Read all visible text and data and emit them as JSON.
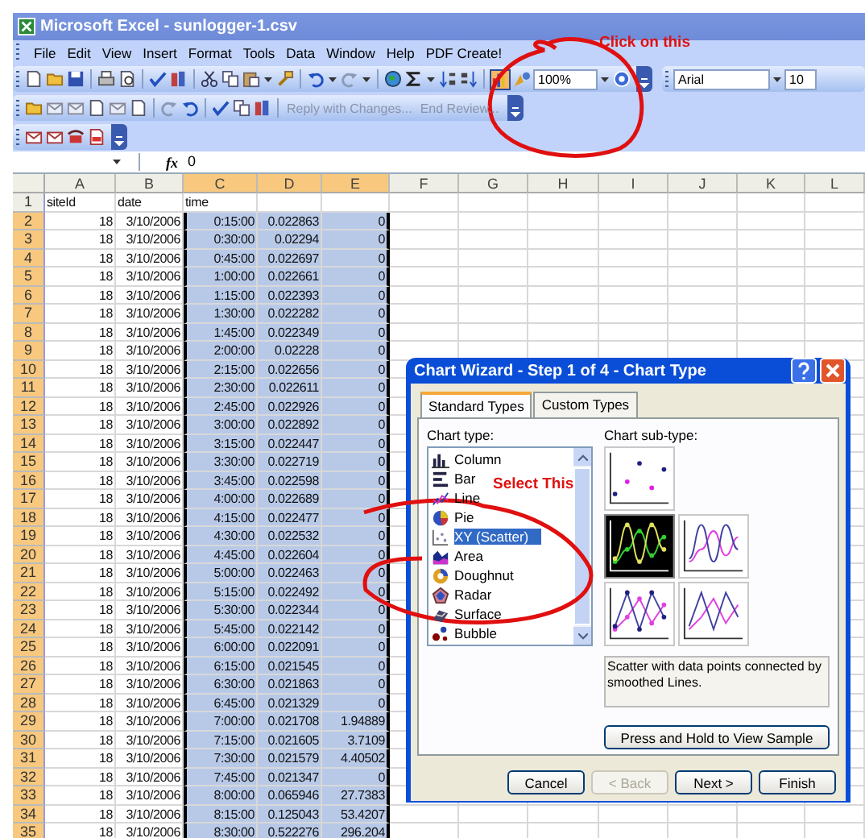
{
  "window": {
    "title": "Microsoft Excel - sunlogger-1.csv"
  },
  "menu": [
    "File",
    "Edit",
    "View",
    "Insert",
    "Format",
    "Tools",
    "Data",
    "Window",
    "Help",
    "PDF Create!"
  ],
  "standard_toolbar": {
    "zoom": "100%",
    "chart_wizard_pressed": true
  },
  "formatting_toolbar": {
    "font": "Arial",
    "size": "10"
  },
  "reviewing_toolbar": {
    "buttons": [
      {
        "label": "Reply with Changes...",
        "disabled": true
      },
      {
        "label": "End Review...",
        "disabled": true
      }
    ]
  },
  "formula_bar": {
    "function_label": "fx",
    "value": "0"
  },
  "sheet": {
    "columns": [
      {
        "label": "A",
        "selected": false
      },
      {
        "label": "B",
        "selected": false
      },
      {
        "label": "C",
        "selected": true
      },
      {
        "label": "D",
        "selected": true
      },
      {
        "label": "E",
        "selected": true
      },
      {
        "label": "F",
        "selected": false
      },
      {
        "label": "G",
        "selected": false
      },
      {
        "label": "H",
        "selected": false
      },
      {
        "label": "I",
        "selected": false
      },
      {
        "label": "J",
        "selected": false
      },
      {
        "label": "K",
        "selected": false
      },
      {
        "label": "L",
        "selected": false
      }
    ],
    "rows": [
      {
        "num": "1",
        "selected": false,
        "cells": [
          "siteId",
          "date",
          "time"
        ]
      },
      {
        "num": "2",
        "selected": true,
        "cells": [
          "18",
          "3/10/2006",
          "0:15:00",
          "0.022863",
          "0"
        ]
      },
      {
        "num": "3",
        "selected": true,
        "cells": [
          "18",
          "3/10/2006",
          "0:30:00",
          "0.02294",
          "0"
        ]
      },
      {
        "num": "4",
        "selected": true,
        "cells": [
          "18",
          "3/10/2006",
          "0:45:00",
          "0.022697",
          "0"
        ]
      },
      {
        "num": "5",
        "selected": true,
        "cells": [
          "18",
          "3/10/2006",
          "1:00:00",
          "0.022661",
          "0"
        ]
      },
      {
        "num": "6",
        "selected": true,
        "cells": [
          "18",
          "3/10/2006",
          "1:15:00",
          "0.022393",
          "0"
        ]
      },
      {
        "num": "7",
        "selected": true,
        "cells": [
          "18",
          "3/10/2006",
          "1:30:00",
          "0.022282",
          "0"
        ]
      },
      {
        "num": "8",
        "selected": true,
        "cells": [
          "18",
          "3/10/2006",
          "1:45:00",
          "0.022349",
          "0"
        ]
      },
      {
        "num": "9",
        "selected": true,
        "cells": [
          "18",
          "3/10/2006",
          "2:00:00",
          "0.02228",
          "0"
        ]
      },
      {
        "num": "10",
        "selected": true,
        "cells": [
          "18",
          "3/10/2006",
          "2:15:00",
          "0.022656",
          "0"
        ]
      },
      {
        "num": "11",
        "selected": true,
        "cells": [
          "18",
          "3/10/2006",
          "2:30:00",
          "0.022611",
          "0"
        ]
      },
      {
        "num": "12",
        "selected": true,
        "cells": [
          "18",
          "3/10/2006",
          "2:45:00",
          "0.022926",
          "0"
        ]
      },
      {
        "num": "13",
        "selected": true,
        "cells": [
          "18",
          "3/10/2006",
          "3:00:00",
          "0.022892",
          "0"
        ]
      },
      {
        "num": "14",
        "selected": true,
        "cells": [
          "18",
          "3/10/2006",
          "3:15:00",
          "0.022447",
          "0"
        ]
      },
      {
        "num": "15",
        "selected": true,
        "cells": [
          "18",
          "3/10/2006",
          "3:30:00",
          "0.022719",
          "0"
        ]
      },
      {
        "num": "16",
        "selected": true,
        "cells": [
          "18",
          "3/10/2006",
          "3:45:00",
          "0.022598",
          "0"
        ]
      },
      {
        "num": "17",
        "selected": true,
        "cells": [
          "18",
          "3/10/2006",
          "4:00:00",
          "0.022689",
          "0"
        ]
      },
      {
        "num": "18",
        "selected": true,
        "cells": [
          "18",
          "3/10/2006",
          "4:15:00",
          "0.022477",
          "0"
        ]
      },
      {
        "num": "19",
        "selected": true,
        "cells": [
          "18",
          "3/10/2006",
          "4:30:00",
          "0.022532",
          "0"
        ]
      },
      {
        "num": "20",
        "selected": true,
        "cells": [
          "18",
          "3/10/2006",
          "4:45:00",
          "0.022604",
          "0"
        ]
      },
      {
        "num": "21",
        "selected": true,
        "cells": [
          "18",
          "3/10/2006",
          "5:00:00",
          "0.022463",
          "0"
        ]
      },
      {
        "num": "22",
        "selected": true,
        "cells": [
          "18",
          "3/10/2006",
          "5:15:00",
          "0.022492",
          "0"
        ]
      },
      {
        "num": "23",
        "selected": true,
        "cells": [
          "18",
          "3/10/2006",
          "5:30:00",
          "0.022344",
          "0"
        ]
      },
      {
        "num": "24",
        "selected": true,
        "cells": [
          "18",
          "3/10/2006",
          "5:45:00",
          "0.022142",
          "0"
        ]
      },
      {
        "num": "25",
        "selected": true,
        "cells": [
          "18",
          "3/10/2006",
          "6:00:00",
          "0.022091",
          "0"
        ]
      },
      {
        "num": "26",
        "selected": true,
        "cells": [
          "18",
          "3/10/2006",
          "6:15:00",
          "0.021545",
          "0"
        ]
      },
      {
        "num": "27",
        "selected": true,
        "cells": [
          "18",
          "3/10/2006",
          "6:30:00",
          "0.021863",
          "0"
        ]
      },
      {
        "num": "28",
        "selected": true,
        "cells": [
          "18",
          "3/10/2006",
          "6:45:00",
          "0.021329",
          "0"
        ]
      },
      {
        "num": "29",
        "selected": true,
        "cells": [
          "18",
          "3/10/2006",
          "7:00:00",
          "0.021708",
          "1.94889"
        ]
      },
      {
        "num": "30",
        "selected": true,
        "cells": [
          "18",
          "3/10/2006",
          "7:15:00",
          "0.021605",
          "3.7109"
        ]
      },
      {
        "num": "31",
        "selected": true,
        "cells": [
          "18",
          "3/10/2006",
          "7:30:00",
          "0.021579",
          "4.40502"
        ]
      },
      {
        "num": "32",
        "selected": true,
        "cells": [
          "18",
          "3/10/2006",
          "7:45:00",
          "0.021347",
          "0"
        ]
      },
      {
        "num": "33",
        "selected": true,
        "cells": [
          "18",
          "3/10/2006",
          "8:00:00",
          "0.065946",
          "27.7383"
        ]
      },
      {
        "num": "34",
        "selected": true,
        "cells": [
          "18",
          "3/10/2006",
          "8:15:00",
          "0.125043",
          "53.4207"
        ]
      },
      {
        "num": "35",
        "selected": true,
        "cells": [
          "18",
          "3/10/2006",
          "8:30:00",
          "0.522276",
          "296.204"
        ]
      }
    ]
  },
  "chart_wizard": {
    "title": "Chart Wizard - Step 1 of 4 - Chart Type",
    "tabs": [
      {
        "label": "Standard Types",
        "selected": true
      },
      {
        "label": "Custom Types",
        "selected": false
      }
    ],
    "chart_type_label": "Chart type:",
    "chart_types": [
      {
        "label": "Column",
        "kind": "column",
        "selected": false
      },
      {
        "label": "Bar",
        "kind": "bar",
        "selected": false
      },
      {
        "label": "Line",
        "kind": "line",
        "selected": false
      },
      {
        "label": "Pie",
        "kind": "pie",
        "selected": false
      },
      {
        "label": "XY (Scatter)",
        "kind": "scatter",
        "selected": true
      },
      {
        "label": "Area",
        "kind": "area",
        "selected": false
      },
      {
        "label": "Doughnut",
        "kind": "doughnut",
        "selected": false
      },
      {
        "label": "Radar",
        "kind": "radar",
        "selected": false
      },
      {
        "label": "Surface",
        "kind": "surface",
        "selected": false
      },
      {
        "label": "Bubble",
        "kind": "bubble",
        "selected": false
      }
    ],
    "subtype_label": "Chart sub-type:",
    "subtypes": [
      {
        "kind": "markers",
        "selected": false
      },
      {
        "kind": "smooth-markers",
        "selected": true
      },
      {
        "kind": "smooth",
        "selected": false
      },
      {
        "kind": "straight-markers",
        "selected": false
      },
      {
        "kind": "straight",
        "selected": false
      }
    ],
    "description": "Scatter with data points connected by smoothed Lines.",
    "sample_button": "Press and Hold to View Sample",
    "buttons": [
      {
        "label": "Cancel",
        "disabled": false
      },
      {
        "label": "< Back",
        "disabled": true
      },
      {
        "label": "Next >",
        "disabled": false
      },
      {
        "label": "Finish",
        "disabled": false
      }
    ]
  },
  "annotations": [
    {
      "text": "Click on this"
    },
    {
      "text": "Select This"
    }
  ]
}
